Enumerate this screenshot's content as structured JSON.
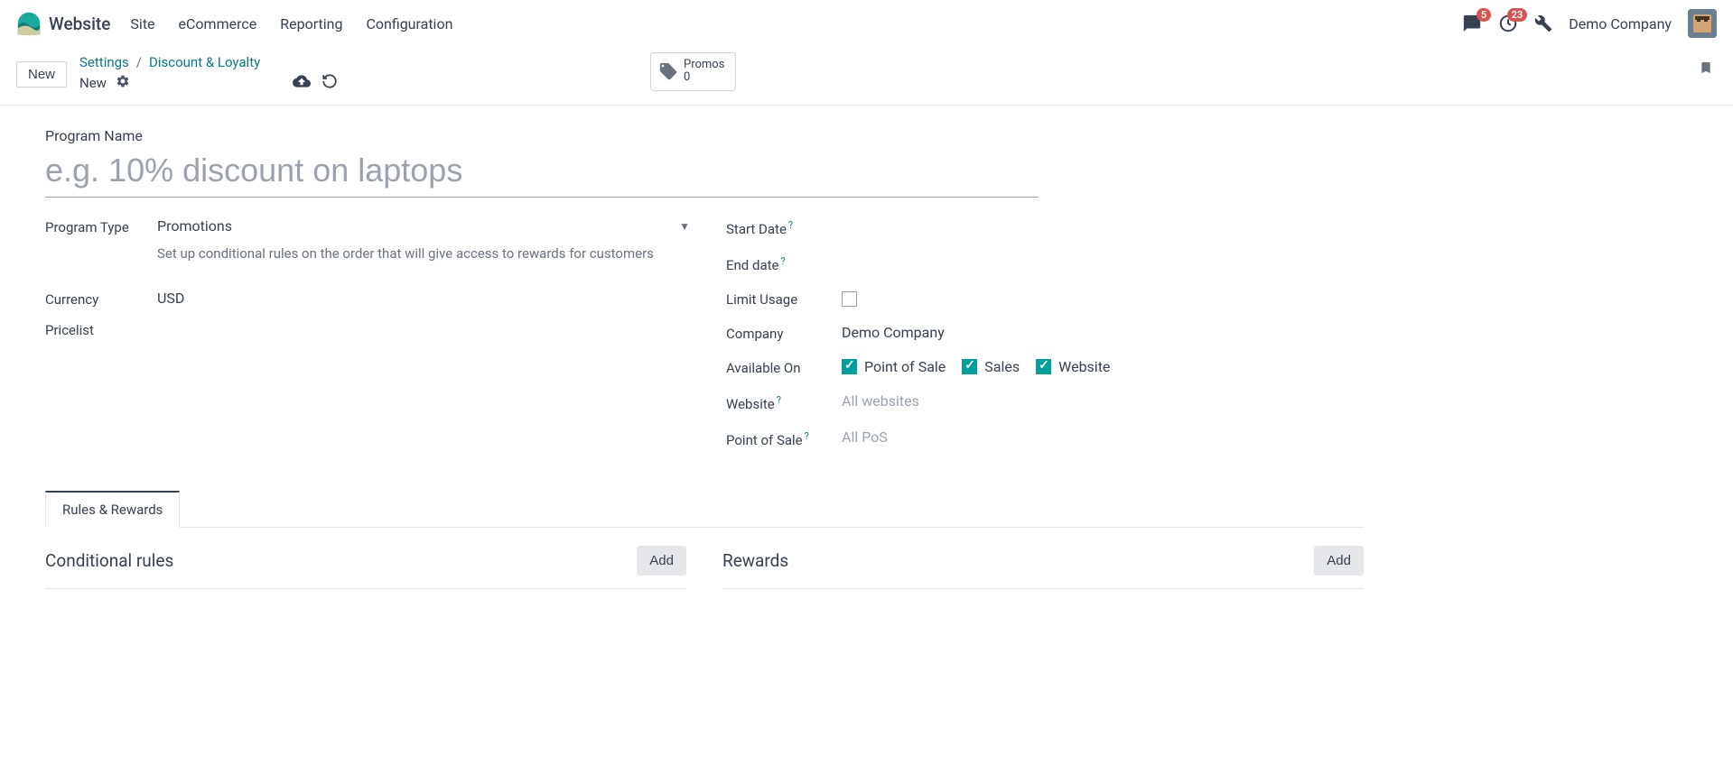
{
  "topnav": {
    "app_name": "Website",
    "menu": [
      "Site",
      "eCommerce",
      "Reporting",
      "Configuration"
    ],
    "chat_badge": "5",
    "activity_badge": "23",
    "company": "Demo Company"
  },
  "controlbar": {
    "new_btn": "New",
    "breadcrumb": {
      "settings": "Settings",
      "discount": "Discount & Loyalty"
    },
    "current": "New",
    "stat": {
      "label": "Promos",
      "value": "0"
    }
  },
  "form": {
    "program_name_label": "Program Name",
    "program_name_placeholder": "e.g. 10% discount on laptops",
    "left": {
      "program_type_label": "Program Type",
      "program_type_value": "Promotions",
      "program_type_desc": "Set up conditional rules on the order that will give access to rewards for customers",
      "currency_label": "Currency",
      "currency_value": "USD",
      "pricelist_label": "Pricelist"
    },
    "right": {
      "start_date_label": "Start Date",
      "end_date_label": "End date",
      "limit_usage_label": "Limit Usage",
      "company_label": "Company",
      "company_value": "Demo Company",
      "available_on_label": "Available On",
      "pos_label": "Point of Sale",
      "sales_label": "Sales",
      "website_chk_label": "Website",
      "website_label": "Website",
      "website_placeholder": "All websites",
      "pos_sel_label": "Point of Sale",
      "pos_sel_placeholder": "All PoS"
    },
    "tab_label": "Rules & Rewards",
    "rules_title": "Conditional rules",
    "rewards_title": "Rewards",
    "add_label": "Add"
  }
}
